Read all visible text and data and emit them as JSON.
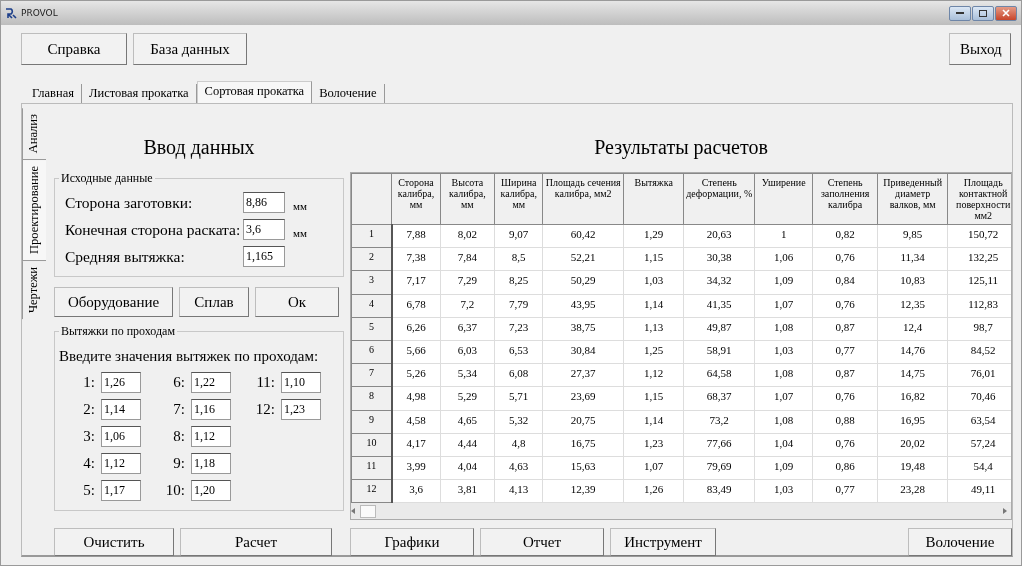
{
  "window": {
    "title": "PROVOL"
  },
  "toolbar": {
    "buttons": [
      "Справка",
      "База данных"
    ],
    "exit": "Выход"
  },
  "tabs": [
    {
      "label": "Главная",
      "selected": false
    },
    {
      "label": "Листовая прокатка",
      "selected": false
    },
    {
      "label": "Сортовая прокатка",
      "selected": true
    },
    {
      "label": "Волочение",
      "selected": false
    }
  ],
  "side_tabs": [
    {
      "label": "Анализ",
      "selected": false
    },
    {
      "label": "Проектирование",
      "selected": true
    },
    {
      "label": "Чертежи",
      "selected": false
    }
  ],
  "input": {
    "title": "Ввод данных",
    "group_title": "Исходные данные",
    "fields": [
      {
        "label": "Сторона заготовки:",
        "value": "8,86",
        "unit": "мм"
      },
      {
        "label": "Конечная сторона раската:",
        "value": "3,6",
        "unit": "мм"
      },
      {
        "label": "Средняя вытяжка:",
        "value": "1,165"
      }
    ],
    "buttons": [
      "Оборудование",
      "Сплав",
      "Ок"
    ]
  },
  "passes": {
    "group_title": "Вытяжки по проходам",
    "prompt": "Введите значения вытяжек по проходам:",
    "items": [
      {
        "label": "1:",
        "value": "1,26"
      },
      {
        "label": "2:",
        "value": "1,14"
      },
      {
        "label": "3:",
        "value": "1,06"
      },
      {
        "label": "4:",
        "value": "1,12"
      },
      {
        "label": "5:",
        "value": "1,17"
      },
      {
        "label": "6:",
        "value": "1,22"
      },
      {
        "label": "7:",
        "value": "1,16"
      },
      {
        "label": "8:",
        "value": "1,12"
      },
      {
        "label": "9:",
        "value": "1,18"
      },
      {
        "label": "10:",
        "value": "1,20"
      },
      {
        "label": "11:",
        "value": "1,10"
      },
      {
        "label": "12:",
        "value": "1,23"
      }
    ]
  },
  "left_buttons": [
    "Очистить",
    "Расчет"
  ],
  "results": {
    "title": "Результаты расчетов",
    "columns": [
      "Сторона калибра, мм",
      "Высота калибра, мм",
      "Ширина калибра, мм",
      "Площадь сечения калибра, мм2",
      "Вытяжка",
      "Степень деформации, %",
      "Уширение",
      "Степень заполнения калибра",
      "Приведенный диаметр валков, мм",
      "Площадь контактной поверхности мм2"
    ],
    "rows": [
      {
        "header": "1",
        "cells": [
          "7,88",
          "8,02",
          "9,07",
          "60,42",
          "1,29",
          "20,63",
          "1",
          "0,82",
          "9,85",
          "150,72"
        ]
      },
      {
        "header": "2",
        "cells": [
          "7,38",
          "7,84",
          "8,5",
          "52,21",
          "1,15",
          "30,38",
          "1,06",
          "0,76",
          "11,34",
          "132,25"
        ]
      },
      {
        "header": "3",
        "cells": [
          "7,17",
          "7,29",
          "8,25",
          "50,29",
          "1,03",
          "34,32",
          "1,09",
          "0,84",
          "10,83",
          "125,11"
        ]
      },
      {
        "header": "4",
        "cells": [
          "6,78",
          "7,2",
          "7,79",
          "43,95",
          "1,14",
          "41,35",
          "1,07",
          "0,76",
          "12,35",
          "112,83"
        ]
      },
      {
        "header": "5",
        "cells": [
          "6,26",
          "6,37",
          "7,23",
          "38,75",
          "1,13",
          "49,87",
          "1,08",
          "0,87",
          "12,4",
          "98,7"
        ]
      },
      {
        "header": "6",
        "cells": [
          "5,66",
          "6,03",
          "6,53",
          "30,84",
          "1,25",
          "58,91",
          "1,03",
          "0,77",
          "14,76",
          "84,52"
        ]
      },
      {
        "header": "7",
        "cells": [
          "5,26",
          "5,34",
          "6,08",
          "27,37",
          "1,12",
          "64,58",
          "1,08",
          "0,87",
          "14,75",
          "76,01"
        ]
      },
      {
        "header": "8",
        "cells": [
          "4,98",
          "5,29",
          "5,71",
          "23,69",
          "1,15",
          "68,37",
          "1,07",
          "0,76",
          "16,82",
          "70,46"
        ]
      },
      {
        "header": "9",
        "cells": [
          "4,58",
          "4,65",
          "5,32",
          "20,75",
          "1,14",
          "73,2",
          "1,08",
          "0,88",
          "16,95",
          "63,54"
        ]
      },
      {
        "header": "10",
        "cells": [
          "4,17",
          "4,44",
          "4,8",
          "16,75",
          "1,23",
          "77,66",
          "1,04",
          "0,76",
          "20,02",
          "57,24"
        ]
      },
      {
        "header": "11",
        "cells": [
          "3,99",
          "4,04",
          "4,63",
          "15,63",
          "1,07",
          "79,69",
          "1,09",
          "0,86",
          "19,48",
          "54,4"
        ]
      },
      {
        "header": "12",
        "cells": [
          "3,6",
          "3,81",
          "4,13",
          "12,39",
          "1,26",
          "83,49",
          "1,03",
          "0,77",
          "23,28",
          "49,11"
        ]
      }
    ]
  },
  "right_buttons": [
    "Графики",
    "Отчет",
    "Инструмент"
  ],
  "drawing_button": "Волочение"
}
